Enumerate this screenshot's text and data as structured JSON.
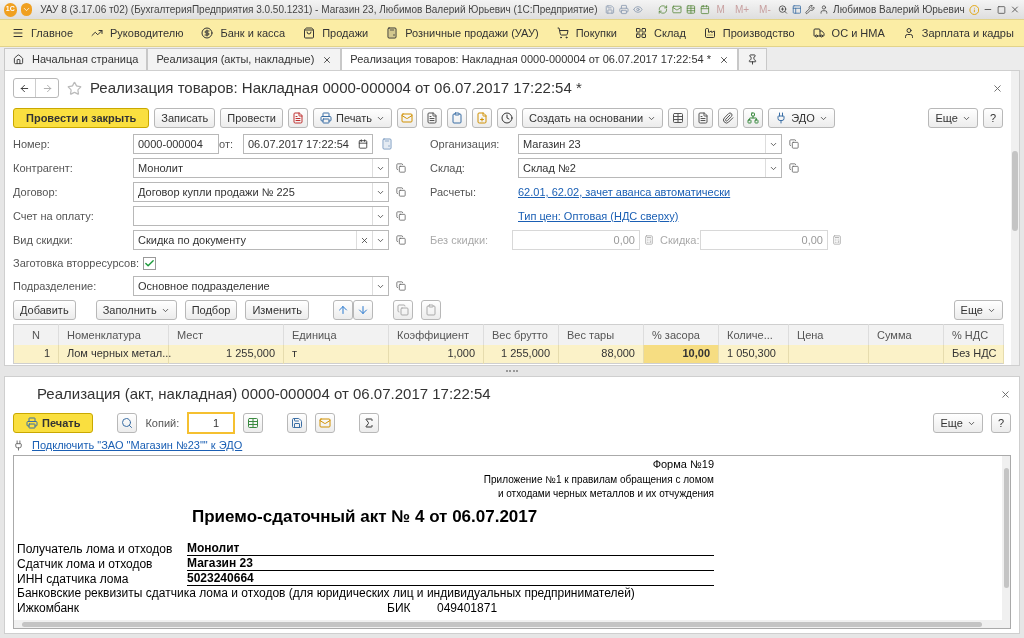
{
  "window": {
    "logo": "1С",
    "title": "УАУ 8 (3.17.06 т02) (БухгалтерияПредприятия 3.0.50.1231) - Магазин 23, Любимов Валерий Юрьевич  (1С:Предприятие)",
    "memory_buttons": [
      "M",
      "M+",
      "M-"
    ],
    "user": "Любимов Валерий Юрьевич"
  },
  "sections": [
    {
      "label": "Главное"
    },
    {
      "label": "Руководителю"
    },
    {
      "label": "Банк и касса"
    },
    {
      "label": "Продажи"
    },
    {
      "label": "Розничные продажи (УАУ)"
    },
    {
      "label": "Покупки"
    },
    {
      "label": "Склад"
    },
    {
      "label": "Производство"
    },
    {
      "label": "ОС и НМА"
    },
    {
      "label": "Зарплата и кадры"
    }
  ],
  "tabs": [
    {
      "kind": "home",
      "label": "Начальная страница",
      "selected": false,
      "closable": false
    },
    {
      "kind": "page",
      "label": "Реализация (акты, накладные)",
      "selected": false,
      "closable": true
    },
    {
      "kind": "page",
      "label": "Реализация товаров: Накладная 0000-000004 от 06.07.2017 17:22:54 *",
      "selected": true,
      "closable": true
    },
    {
      "kind": "pin",
      "selected": false,
      "closable": false
    }
  ],
  "document": {
    "title": "Реализация товаров: Накладная 0000-000004 от 06.07.2017 17:22:54 *",
    "toolbar": {
      "post_close": "Провести и закрыть",
      "save": "Записать",
      "post": "Провести",
      "print": "Печать",
      "create_based": "Создать на основании",
      "edo": "ЭДО",
      "more": "Еще",
      "help": "?"
    },
    "number": {
      "label": "Номер:",
      "value": "0000-000004"
    },
    "date": {
      "label": "от:",
      "value": "06.07.2017 17:22:54"
    },
    "left_fields": [
      {
        "label": "Контрагент:",
        "value": "Монолит",
        "clearable": false
      },
      {
        "label": "Договор:",
        "value": "Договор купли продажи № 225",
        "clearable": false
      },
      {
        "label": "Счет на оплату:",
        "clearable": false
      },
      {
        "label": "Вид скидки:",
        "value": "Скидка по документу",
        "clearable": true
      }
    ],
    "recycling": {
      "label": "Заготовка вторресурсов:",
      "checked": true
    },
    "department": {
      "label": "Подразделение:",
      "value": "Основное подразделение"
    },
    "organization": {
      "label": "Организация:",
      "value": "Магазин 23"
    },
    "warehouse": {
      "label": "Склад:",
      "value": "Склад №2"
    },
    "payments": {
      "label": "Расчеты:",
      "link": "62.01, 62.02, зачет аванса автоматически"
    },
    "price_type": {
      "link": "Тип цен: Оптовая (НДС сверху)"
    },
    "discounts": [
      {
        "label": "Без скидки:",
        "value": "0,00",
        "disabled": true
      },
      {
        "label": "Скидка:",
        "value": "0,00",
        "disabled": true
      }
    ],
    "table_toolbar": {
      "add": "Добавить",
      "fill": "Заполнить",
      "pick": "Подбор",
      "change": "Изменить",
      "more": "Еще"
    },
    "table": {
      "columns": [
        "N",
        "Номенклатура",
        "Мест",
        "Единица",
        "Коэффициент",
        "Вес брутто",
        "Вес тары",
        "% засора",
        "Количе...",
        "Цена",
        "Сумма",
        "% НДС"
      ],
      "rows": [
        {
          "selected": true,
          "cells": [
            {
              "text": "1",
              "focused": false
            },
            {
              "text": "Лом черных метал...",
              "focused": false
            },
            {
              "text": "1 255,000",
              "focused": false
            },
            {
              "text": "т",
              "focused": false
            },
            {
              "text": "1,000",
              "focused": false
            },
            {
              "text": "1 255,000",
              "focused": false
            },
            {
              "text": "88,000",
              "focused": false
            },
            {
              "text": "10,00",
              "focused": true
            },
            {
              "text": "1 050,300",
              "focused": false
            },
            {
              "focused": false
            },
            {
              "focused": false
            },
            {
              "text": "Без НДС",
              "focused": false
            }
          ]
        }
      ]
    }
  },
  "print_form": {
    "title": "Реализация (акт, накладная) 0000-000004 от 06.07.2017 17:22:54",
    "print": "Печать",
    "copies_label": "Копий:",
    "copies": "1",
    "more": "Еще",
    "help": "?",
    "edo_link": "Подключить \"ЗАО \"Магазин №23\"\" к ЭДО",
    "sheet": {
      "form_no": "Форма №19",
      "annex": [
        "Приложение №1 к правилам обращения с ломом",
        "и отходами черных металлов и их отчуждения"
      ],
      "heading": "Приемо-сдаточный акт № 4 от 06.07.2017",
      "rows": [
        {
          "label": "Получатель лома и отходов",
          "value": "Монолит"
        },
        {
          "label": "Сдатчик лома и отходов",
          "value": "Магазин 23"
        },
        {
          "label": "ИНН сдатчика лома",
          "value": "5023240664"
        }
      ],
      "bank_note": "Банковские реквизиты сдатчика лома и отходов (для юридических лиц и индивидуальных предпринимателей)",
      "bank": "Ижкомбанк",
      "bik_label": "БИК",
      "bik": "049401871"
    }
  }
}
